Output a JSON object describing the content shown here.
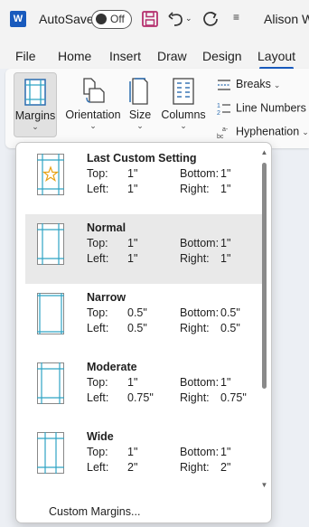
{
  "titlebar": {
    "app_logo": "W",
    "autosave_label": "AutoSave",
    "autosave_state": "Off",
    "user_name": "Alison W",
    "icons": [
      "save-icon",
      "undo-icon",
      "undo-dropdown-icon",
      "redo-icon",
      "customize-qat-icon"
    ]
  },
  "tabs": [
    {
      "label": "File"
    },
    {
      "label": "Home"
    },
    {
      "label": "Insert"
    },
    {
      "label": "Draw"
    },
    {
      "label": "Design"
    },
    {
      "label": "Layout"
    }
  ],
  "active_tab": "Layout",
  "ribbon": {
    "margins": "Margins",
    "orientation": "Orientation",
    "size": "Size",
    "columns": "Columns",
    "breaks": "Breaks",
    "line_numbers": "Line Numbers",
    "hyphenation": "Hyphenation"
  },
  "margins_menu": {
    "items": [
      {
        "title": "Last Custom Setting",
        "top_label": "Top:",
        "top": "1\"",
        "bottom_label": "Bottom:",
        "bottom": "1\"",
        "left_label": "Left:",
        "left": "1\"",
        "right_label": "Right:",
        "right": "1\"",
        "icon": "star-icon"
      },
      {
        "title": "Normal",
        "top_label": "Top:",
        "top": "1\"",
        "bottom_label": "Bottom:",
        "bottom": "1\"",
        "left_label": "Left:",
        "left": "1\"",
        "right_label": "Right:",
        "right": "1\""
      },
      {
        "title": "Narrow",
        "top_label": "Top:",
        "top": "0.5\"",
        "bottom_label": "Bottom:",
        "bottom": "0.5\"",
        "left_label": "Left:",
        "left": "0.5\"",
        "right_label": "Right:",
        "right": "0.5\""
      },
      {
        "title": "Moderate",
        "top_label": "Top:",
        "top": "1\"",
        "bottom_label": "Bottom:",
        "bottom": "1\"",
        "left_label": "Left:",
        "left": "0.75\"",
        "right_label": "Right:",
        "right": "0.75\""
      },
      {
        "title": "Wide",
        "top_label": "Top:",
        "top": "1\"",
        "bottom_label": "Bottom:",
        "bottom": "1\"",
        "left_label": "Left:",
        "left": "2\"",
        "right_label": "Right:",
        "right": "2\""
      }
    ],
    "custom_margins": "Custom Margins..."
  },
  "colors": {
    "accent": "#185abd",
    "guide": "#2fa3c4",
    "star": "#e8a317"
  }
}
